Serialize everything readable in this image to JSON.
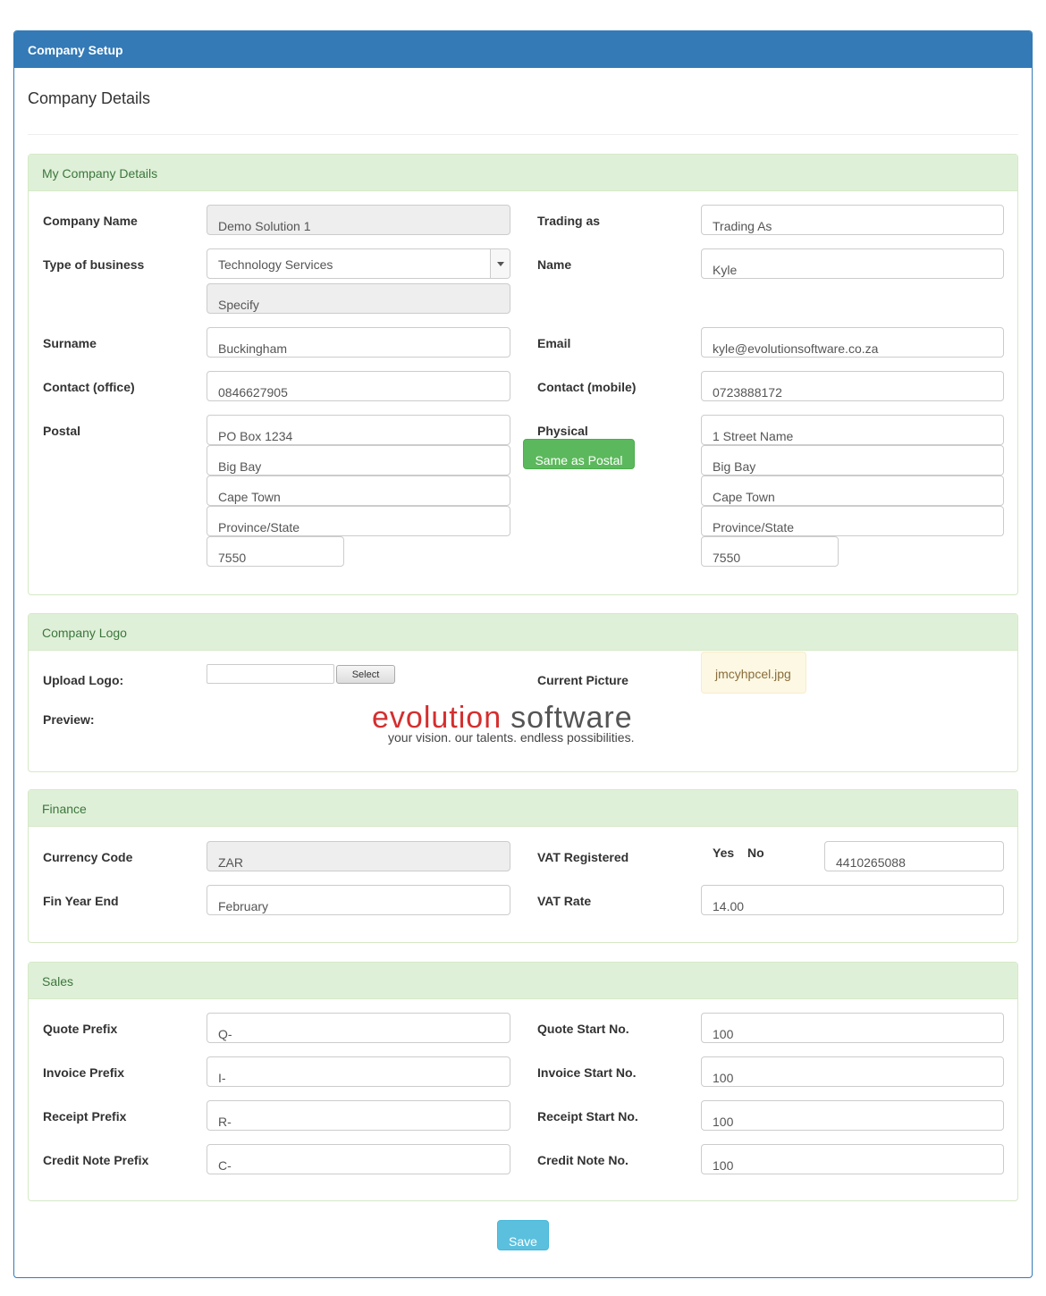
{
  "panel": {
    "title": "Company Setup"
  },
  "page_title": "Company Details",
  "company": {
    "heading": "My Company Details",
    "company_name": {
      "label": "Company Name",
      "value": "Demo Solution 1"
    },
    "trading_as": {
      "label": "Trading as",
      "value": "Trading As"
    },
    "type_of_business": {
      "label": "Type of business",
      "value": "Technology Services",
      "specify": "Specify"
    },
    "name": {
      "label": "Name",
      "value": "Kyle"
    },
    "surname": {
      "label": "Surname",
      "value": "Buckingham"
    },
    "email": {
      "label": "Email",
      "value": "kyle@evolutionsoftware.co.za"
    },
    "contact_office": {
      "label": "Contact (office)",
      "value": "0846627905"
    },
    "contact_mobile": {
      "label": "Contact (mobile)",
      "value": "0723888172"
    },
    "postal": {
      "label": "Postal",
      "line1": "PO Box 1234",
      "line2": "Big Bay",
      "line3": "Cape Town",
      "province": "Province/State",
      "code": "7550"
    },
    "physical": {
      "label": "Physical",
      "line1": "1 Street Name",
      "line2": "Big Bay",
      "line3": "Cape Town",
      "province": "Province/State",
      "code": "7550"
    },
    "same_as_postal": "Same as Postal"
  },
  "logo": {
    "heading": "Company Logo",
    "upload_label": "Upload Logo:",
    "select_button": "Select",
    "current_label": "Current Picture",
    "current_file": "jmcyhpcel.jpg",
    "preview_label": "Preview:",
    "image_text": {
      "part1": "evolution",
      "part2": "software",
      "tagline": "your vision.  our talents.  endless possibilities."
    }
  },
  "finance": {
    "heading": "Finance",
    "currency": {
      "label": "Currency Code",
      "value": "ZAR"
    },
    "vat_registered": {
      "label": "VAT Registered",
      "yes": "Yes",
      "no": "No",
      "number": "4410265088"
    },
    "fin_year_end": {
      "label": "Fin Year End",
      "value": "February"
    },
    "vat_rate": {
      "label": "VAT Rate",
      "value": "14.00"
    }
  },
  "sales": {
    "heading": "Sales",
    "quote_prefix": {
      "label": "Quote Prefix",
      "value": "Q-"
    },
    "quote_start": {
      "label": "Quote Start No.",
      "value": "100"
    },
    "invoice_prefix": {
      "label": "Invoice Prefix",
      "value": "I-"
    },
    "invoice_start": {
      "label": "Invoice Start No.",
      "value": "100"
    },
    "receipt_prefix": {
      "label": "Receipt Prefix",
      "value": "R-"
    },
    "receipt_start": {
      "label": "Receipt Start No.",
      "value": "100"
    },
    "credit_prefix": {
      "label": "Credit Note Prefix",
      "value": "C-"
    },
    "credit_no": {
      "label": "Credit Note No.",
      "value": "100"
    }
  },
  "save_button": "Save",
  "colors": {
    "primary": "#337ab7",
    "success": "#5cb85c",
    "info": "#5bc0de",
    "section_bg": "#dff0d8",
    "section_text": "#3c763d"
  }
}
